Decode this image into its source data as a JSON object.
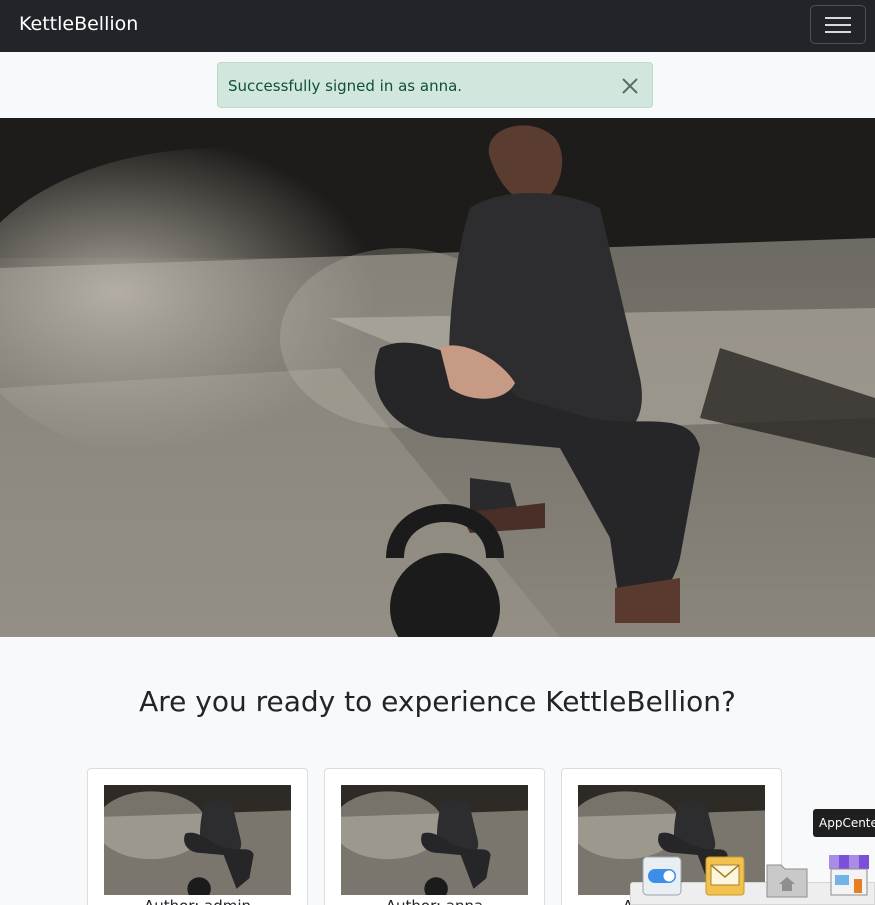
{
  "navbar": {
    "brand": "KettleBellion",
    "menu_toggle_icon": "hamburger-icon"
  },
  "alert": {
    "message": "Successfully signed in as anna.",
    "close_icon": "close-icon",
    "color": "#d1e7dd"
  },
  "hero": {
    "image_subject": "kettlebell-workout-photo"
  },
  "heading": "Are you ready to experience KettleBellion?",
  "cards": [
    {
      "author": "Author: admin"
    },
    {
      "author": "Author: anna"
    },
    {
      "author": "Author: anna"
    }
  ],
  "taskbar": {
    "tooltip": "AppCenter",
    "icons": [
      "toggle-settings-icon",
      "mail-icon",
      "home-folder-icon",
      "appcenter-store-icon"
    ]
  },
  "colors": {
    "navbar": "#212529",
    "page_background": "#f8f9fa",
    "alert_text": "#0f5132"
  }
}
